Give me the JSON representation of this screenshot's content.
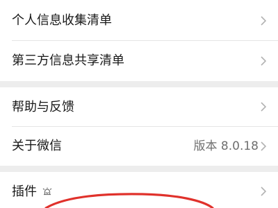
{
  "settings": {
    "items": [
      {
        "label": "个人信息收集清单",
        "value": ""
      },
      {
        "label": "第三方信息共享清单",
        "value": ""
      },
      {
        "label": "帮助与反馈",
        "value": ""
      },
      {
        "label": "关于微信",
        "value": "版本 8.0.18"
      },
      {
        "label": "插件",
        "value": ""
      }
    ]
  },
  "icons": {
    "chevron": "chevron-right-icon",
    "plugin": "plugin-bell-icon"
  },
  "colors": {
    "background": "#ededed",
    "row": "#ffffff",
    "text": "#191919",
    "secondary": "#6f6f6f",
    "chevron": "#b2b2b2",
    "annotation": "#e0312b"
  }
}
